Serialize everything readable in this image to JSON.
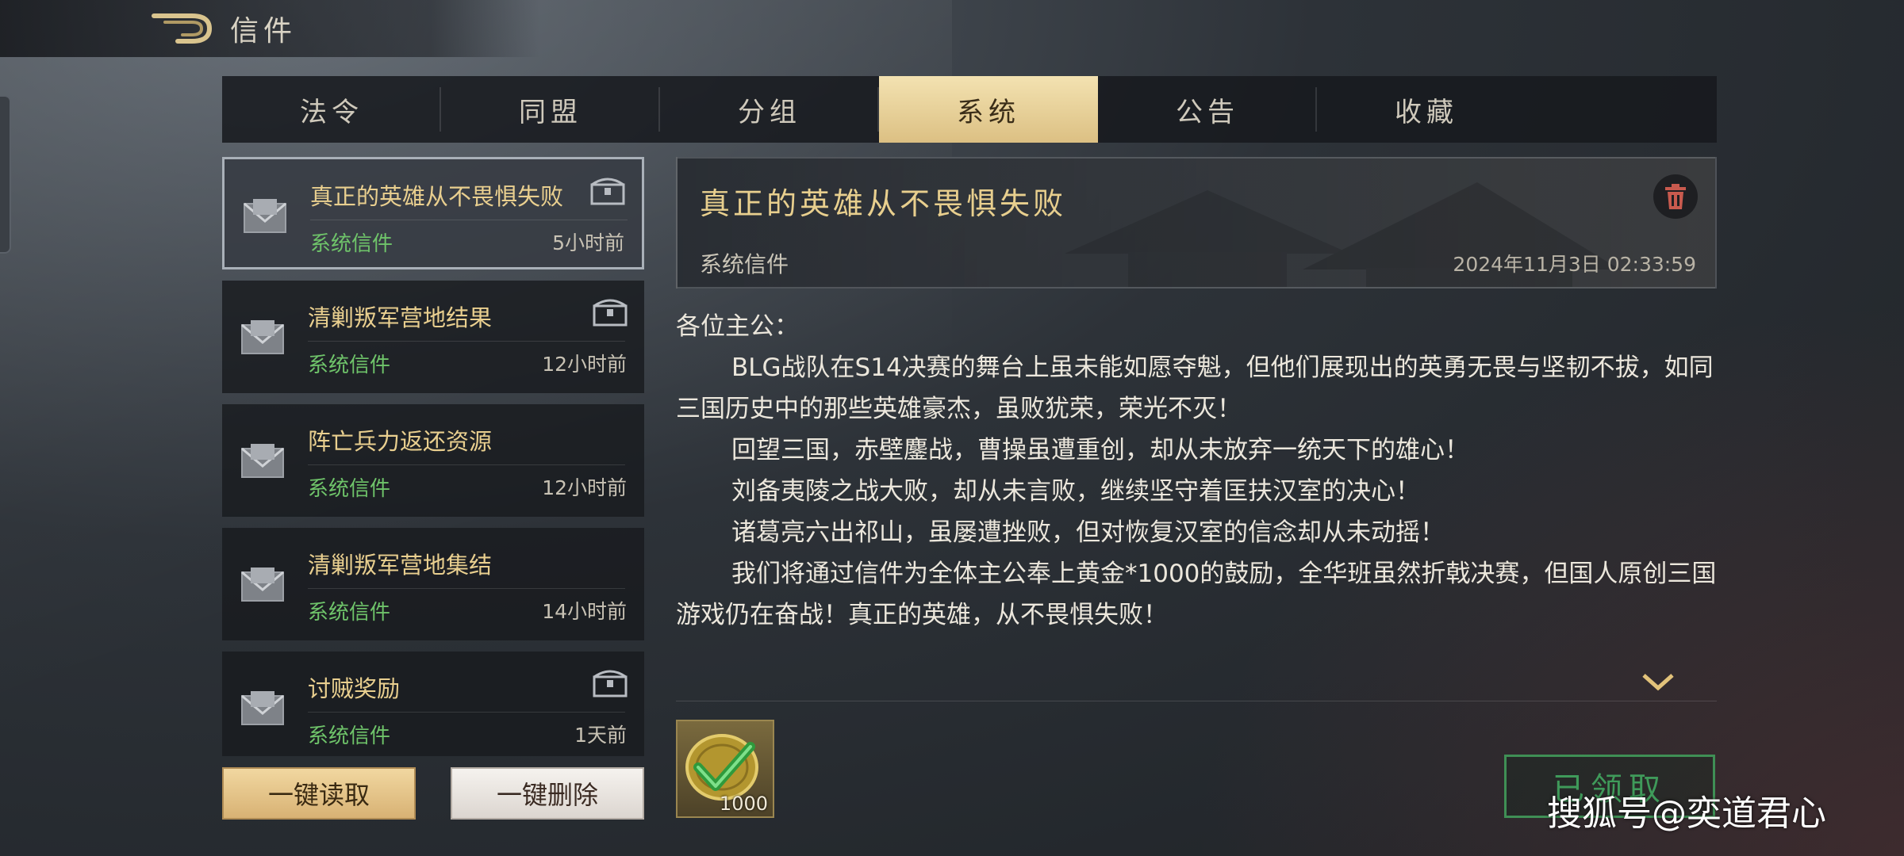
{
  "header": {
    "title": "信件"
  },
  "tabs": [
    {
      "label": "法令"
    },
    {
      "label": "同盟"
    },
    {
      "label": "分组"
    },
    {
      "label": "系统"
    },
    {
      "label": "公告"
    },
    {
      "label": "收藏"
    }
  ],
  "active_tab": "系统",
  "mails": [
    {
      "title": "真正的英雄从不畏惧失败",
      "sender": "系统信件",
      "time": "5小时前",
      "has_attachment": true
    },
    {
      "title": "清剿叛军营地结果",
      "sender": "系统信件",
      "time": "12小时前",
      "has_attachment": true
    },
    {
      "title": "阵亡兵力返还资源",
      "sender": "系统信件",
      "time": "12小时前",
      "has_attachment": false
    },
    {
      "title": "清剿叛军营地集结",
      "sender": "系统信件",
      "time": "14小时前",
      "has_attachment": false
    },
    {
      "title": "讨贼奖励",
      "sender": "系统信件",
      "time": "1天前",
      "has_attachment": true
    }
  ],
  "buttons": {
    "read_all": "一键读取",
    "delete_all": "一键删除",
    "claimed": "已领取"
  },
  "detail": {
    "title": "真正的英雄从不畏惧失败",
    "sender": "系统信件",
    "date": "2024年11月3日 02:33:59",
    "greeting": "各位主公：",
    "paragraphs": [
      "BLG战队在S14决赛的舞台上虽未能如愿夺魁，但他们展现出的英勇无畏与坚韧不拔，如同三国历史中的那些英雄豪杰，虽败犹荣，荣光不灭！",
      "回望三国，赤壁鏖战，曹操虽遭重创，却从未放弃一统天下的雄心！",
      "刘备夷陵之战大败，却从未言败，继续坚守着匡扶汉室的决心！",
      "诸葛亮六出祁山，虽屡遭挫败，但对恢复汉室的信念却从未动摇！",
      "我们将通过信件为全体主公奉上黄金*1000的鼓励，全华班虽然折戟决赛，但国人原创三国游戏仍在奋战！真正的英雄，从不畏惧失败！"
    ],
    "reward": {
      "item": "gold-coin-icon",
      "quantity": "1000"
    }
  },
  "watermark": "搜狐号@奕道君心",
  "colors": {
    "accent_gold": "#e8cf8e",
    "sender_green": "#6fc46a",
    "claimed_green": "#3f8f55"
  }
}
